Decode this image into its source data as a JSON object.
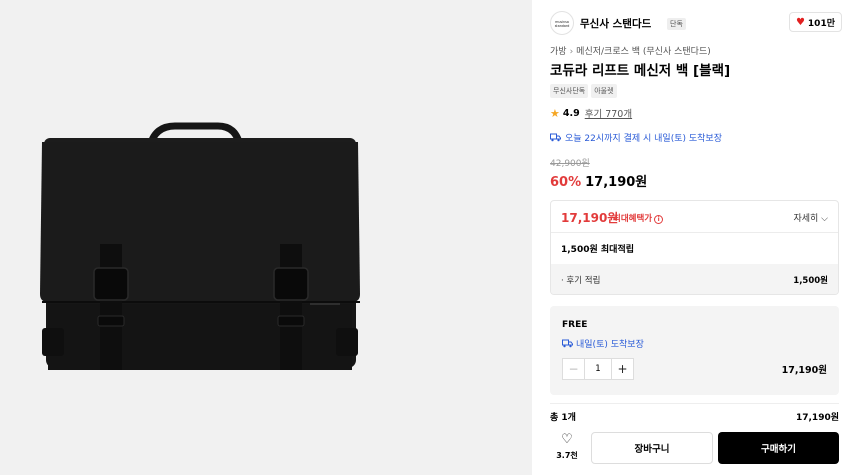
{
  "brand": {
    "logo_text": "musinsa standard",
    "name": "무신사 스탠다드",
    "badge": "단독",
    "likes": "101만"
  },
  "breadcrumb": [
    "가방",
    "메신저/크로스 백 (무신사 스탠다드)"
  ],
  "product": {
    "title": "코듀라 리프트 메신저 백 [블랙]",
    "tags": [
      "무신사단독",
      "아울렛"
    ],
    "rating": "4.9",
    "reviews": "후기 770개",
    "delivery": "오늘 22시까지 결제 시 내일(토) 도착보장",
    "original_price": "42,900원",
    "discount": "60%",
    "price": "17,190원"
  },
  "benefit": {
    "price": "17,190원",
    "label": "최대혜택가",
    "detail": "자세히",
    "points": "1,500원 최대적립",
    "review_label": "· 후기 적립",
    "review_amount": "1,500원"
  },
  "option": {
    "name": "FREE",
    "delivery": "내일(토) 도착보장",
    "quantity": "1",
    "price": "17,190원"
  },
  "total": {
    "label": "총 1개",
    "amount": "17,190원"
  },
  "actions": {
    "wish_count": "3.7천",
    "cart": "장바구니",
    "buy": "구매하기"
  },
  "colors": {
    "accent_red": "#e23b3b",
    "link_blue": "#2a5bd7",
    "star": "#f5a623"
  }
}
